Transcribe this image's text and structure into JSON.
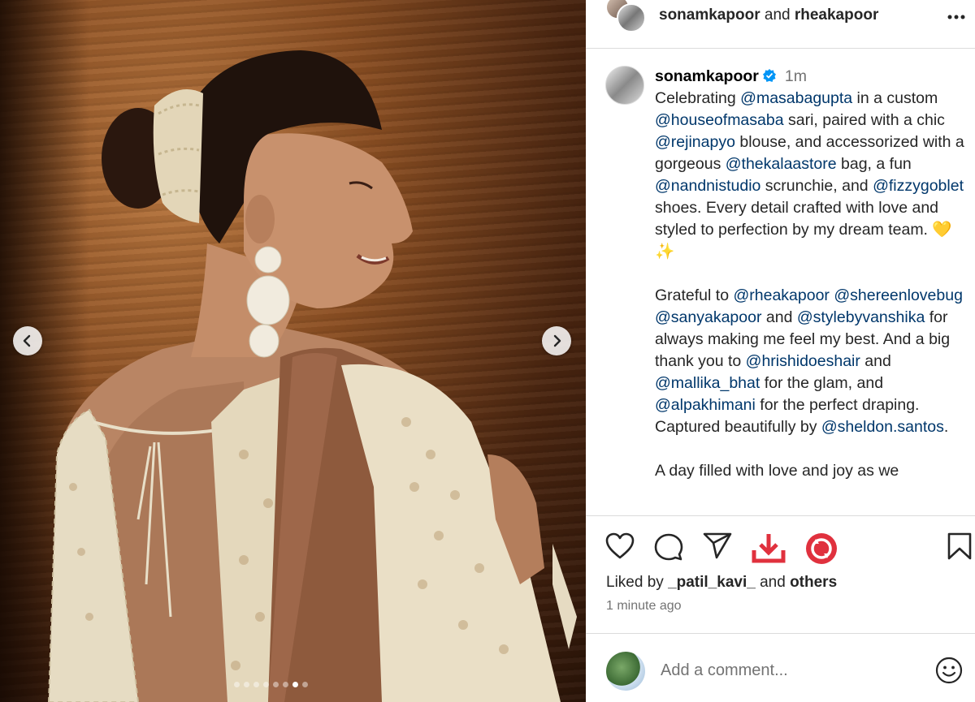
{
  "post": {
    "header": {
      "user1": "sonamkapoor",
      "and_text": "and",
      "user2": "rheakapoor",
      "more_icon": "more-horizontal-icon"
    },
    "carousel": {
      "prev_icon": "chevron-left-icon",
      "next_icon": "chevron-right-icon",
      "dot_count": 8,
      "active_index": 6
    },
    "caption": {
      "username": "sonamkapoor",
      "time": "1m",
      "p1": [
        {
          "t": "Celebrating "
        },
        {
          "m": "@masabagupta"
        },
        {
          "t": " in a custom "
        },
        {
          "m": "@houseofmasaba"
        },
        {
          "t": " sari, paired with a chic "
        },
        {
          "m": "@rejinapyo"
        },
        {
          "t": " blouse, and accessorized with a gorgeous "
        },
        {
          "m": "@thekalaastore"
        },
        {
          "t": " bag, a fun "
        },
        {
          "m": "@nandnistudio"
        },
        {
          "t": " scrunchie, and "
        },
        {
          "m": "@fizzygoblet"
        },
        {
          "t": " shoes. Every detail crafted with love and styled to perfection by my dream team. 💛 ✨"
        }
      ],
      "p2": [
        {
          "t": "Grateful to "
        },
        {
          "m": "@rheakapoor"
        },
        {
          "t": " "
        },
        {
          "m": "@shereenlovebug"
        },
        {
          "t": " "
        },
        {
          "m": "@sanyakapoor"
        },
        {
          "t": " and "
        },
        {
          "m": "@stylebyvanshika"
        },
        {
          "t": " for always making me feel my best. And a big thank you to "
        },
        {
          "m": "@hrishidoeshair"
        },
        {
          "t": " and "
        },
        {
          "m": "@mallika_bhat"
        },
        {
          "t": " for the glam, and "
        },
        {
          "m": "@alpakhimani"
        },
        {
          "t": " for the perfect draping. Captured beautifully by "
        },
        {
          "m": "@sheldon.santos"
        },
        {
          "t": "."
        }
      ],
      "p3": [
        {
          "t": "A day filled with love and joy as we"
        }
      ]
    },
    "actions": {
      "like_icon": "heart-icon",
      "comment_icon": "comment-icon",
      "share_icon": "send-icon",
      "download_icon": "download-icon",
      "extra_icon": "repost-icon",
      "save_icon": "bookmark-icon",
      "download_color": "#e0313e",
      "extra_color": "#e0313e"
    },
    "likes": {
      "prefix": "Liked by",
      "user": "_patil_kavi_",
      "mid": "and",
      "others": "others"
    },
    "timestamp": "1 minute ago",
    "comment": {
      "placeholder": "Add a comment...",
      "emoji_icon": "emoji-icon"
    }
  }
}
